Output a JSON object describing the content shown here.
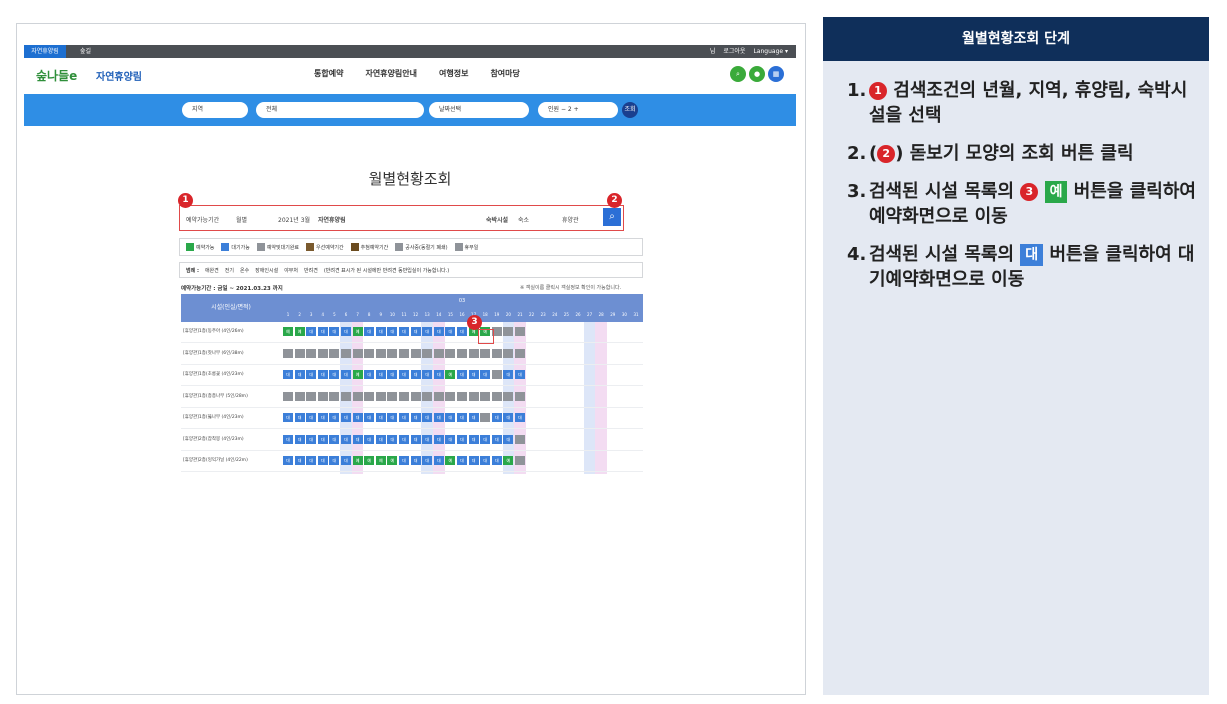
{
  "screenshot": {
    "topbar": {
      "tab_active": "자연휴양림",
      "tab_other": "숲길",
      "right_items": [
        "님",
        "로그아웃",
        "Language ▾"
      ]
    },
    "header": {
      "logo": "숲나들e",
      "site_name": "자연휴양림",
      "nav": [
        "통합예약",
        "자연휴양림안내",
        "여행정보",
        "참여마당"
      ],
      "icons": [
        "search-icon",
        "user-icon",
        "grid-icon"
      ]
    },
    "searchbar": {
      "region": "지역",
      "forest": "전체",
      "date": "날짜선택",
      "persons_label": "인원",
      "persons_value": "2",
      "search": "조회"
    },
    "title": "월별현황조회",
    "conditions": {
      "opt1": "예약가능기간",
      "opt2": "월별",
      "month": "2021년 3월",
      "forest_label": "자연휴양림",
      "facility_label": "숙박시설",
      "facility_value": "숙소",
      "extra": "휴양관"
    },
    "legend": [
      "예약가능",
      "대기가능",
      "예약및대기완료",
      "우선예약기간",
      "추첨예약기간",
      "공사중(동절기 폐쇄)",
      "휴무일"
    ],
    "legend_colors": [
      "#2aa84a",
      "#3c7fd9",
      "#8f9399",
      "#7a5a2e",
      "#6b4b1f",
      "#8f9399",
      "#8f9399"
    ],
    "legend2_label": "범례 :",
    "legend2": [
      "애완견",
      "전기",
      "온수",
      "장애인시설",
      "야부처",
      "반려견"
    ],
    "legend2_note": "(반려견 표시가 된 시설에만 반려견 동반입실이 가능합니다.)",
    "period": "예약가능기간 : 금일 ~ 2021.03.23 까지",
    "note": "※ 객실이름 클릭시 객실정보 확인이 가능합니다.",
    "grid": {
      "col_header": "시설(인실/면적)",
      "month_header": "03",
      "days": [
        "1",
        "2",
        "3",
        "4",
        "5",
        "6",
        "7",
        "8",
        "9",
        "10",
        "11",
        "12",
        "13",
        "14",
        "15",
        "16",
        "17",
        "18",
        "19",
        "20",
        "21",
        "22",
        "23",
        "24",
        "25",
        "26",
        "27",
        "28",
        "29",
        "30",
        "31"
      ],
      "rows": [
        {
          "name": "[휴양관]1층(동주아 (4인/26m)",
          "cells": "TTBBBBTBBBBBBBBBTTGGG"
        },
        {
          "name": "[휴양관]1층(잣나무 (6인/38m)",
          "cells": "GGGGGGGGGGGGGGGGGGGGG"
        },
        {
          "name": "[휴양관]1층(초롱꽃 (4인/23m)",
          "cells": "BBBBBBTBBBBBBBTBBBGBB"
        },
        {
          "name": "[휴양관]1층(층층나무 (5인/28m)",
          "cells": "GGGGGGGGGGGGGGGGGGGGG"
        },
        {
          "name": "[휴양관]1층(뚫나무 (4인/23m)",
          "cells": "BBBBBBBBBBBBBBBBBGBBB"
        },
        {
          "name": "[휴양관]2층(잡착봉 (4인/23m)",
          "cells": "BBBBBBBBBBBBBBBBBBBBG"
        },
        {
          "name": "[휴양관]2층(잉익가닐 (4인/22m)",
          "cells": "BBBBBBTTTTBBBBTBBBBTG"
        }
      ]
    }
  },
  "panel": {
    "title": "월별현황조회 단계",
    "steps": [
      {
        "num": "1.",
        "marker": "1",
        "text": "검색조건의 년월, 지역, 휴양림, 숙박시설을 선택"
      },
      {
        "num": "2.",
        "pre": "(",
        "marker": "2",
        "text": ") 돋보기 모양의 조회 버튼 클릭"
      },
      {
        "num": "3.",
        "pre": "검색된 시설 목록의",
        "marker": "3",
        "chip": "예",
        "chip_color": "#2aa84a",
        "text": "버튼을 클릭하여 예약화면으로 이동"
      },
      {
        "num": "4.",
        "pre": "검색된 시설 목록의",
        "chip": "대",
        "chip_color": "#3c7fd9",
        "text": "버튼을 클릭하여 대기예약화면으로 이동"
      }
    ]
  },
  "markers": [
    "1",
    "2",
    "3"
  ]
}
